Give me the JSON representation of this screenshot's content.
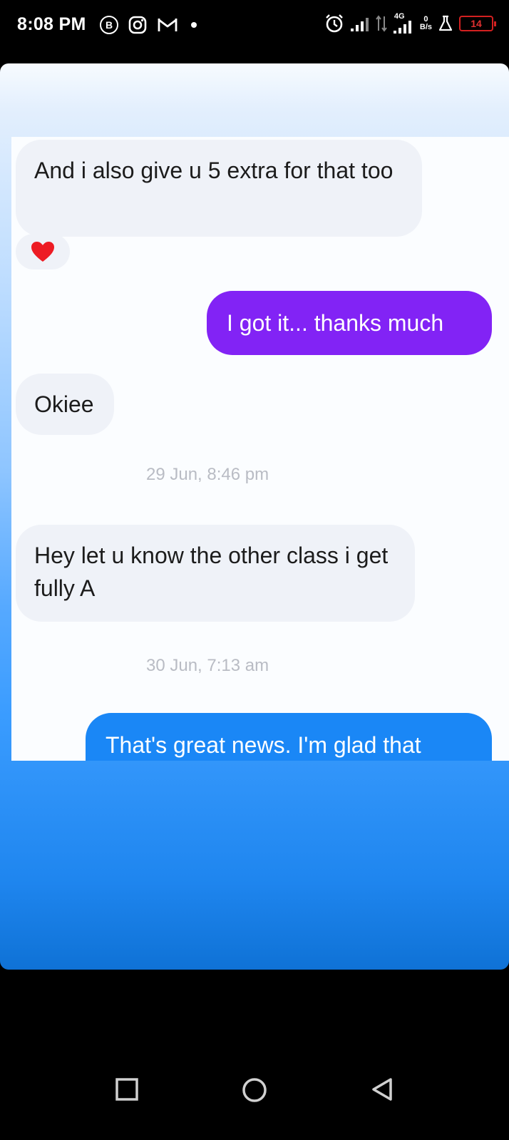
{
  "status_bar": {
    "time": "8:08 PM",
    "b_label": "B",
    "network": "4G",
    "speed_value": "0",
    "speed_unit": "B/s",
    "battery": "14"
  },
  "messages": [
    {
      "direction": "incoming",
      "text": "And i also give u 5 extra for that too",
      "reaction": "heart"
    },
    {
      "direction": "outgoing",
      "text": "I got it... thanks much",
      "color": "#8223f5"
    },
    {
      "direction": "incoming",
      "text": "Okiee"
    },
    {
      "direction": "timestamp",
      "text": "29 Jun, 8:46 pm"
    },
    {
      "direction": "incoming",
      "text": "Hey let u know the other class i get fully A"
    },
    {
      "direction": "timestamp",
      "text": "30 Jun, 7:13 am"
    },
    {
      "direction": "outgoing",
      "text": "That's great news. I'm glad that",
      "color": "#1a87f6"
    }
  ],
  "icons": {
    "status_left": [
      "business-icon",
      "instagram-icon",
      "gmail-icon",
      "notification-dot"
    ],
    "status_right": [
      "alarm-icon",
      "signal-icon",
      "data-arrows-icon",
      "signal-4g-icon",
      "speed-icon",
      "flask-icon",
      "battery-icon"
    ],
    "nav": [
      "recents-square-icon",
      "home-circle-icon",
      "back-triangle-icon"
    ]
  }
}
